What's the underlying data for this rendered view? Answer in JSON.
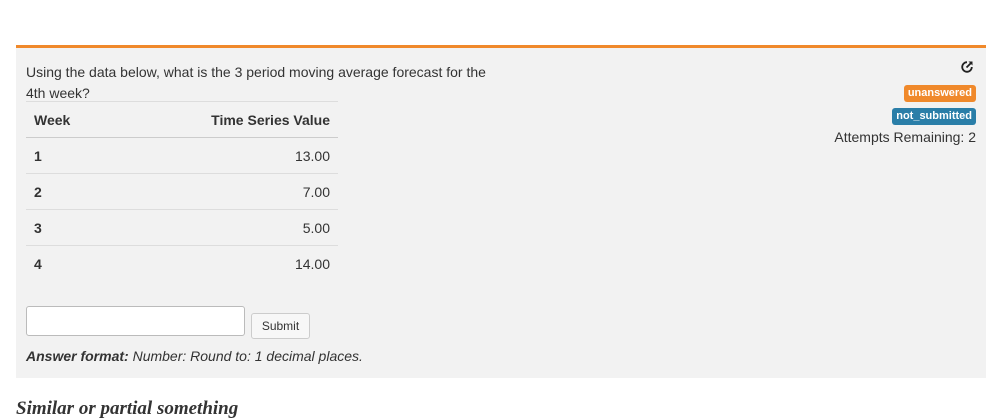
{
  "question": {
    "text": "Using the data below, what is the 3 period moving average forecast for the 4th week?"
  },
  "table": {
    "headers": [
      "Week",
      "Time Series Value"
    ],
    "rows": [
      [
        "1",
        "13.00"
      ],
      [
        "2",
        "7.00"
      ],
      [
        "3",
        "5.00"
      ],
      [
        "4",
        "14.00"
      ]
    ]
  },
  "status": {
    "answered_badge": "unanswered",
    "submitted_badge": "not_submitted",
    "attempts": "Attempts Remaining: 2",
    "icons": [
      "share-icon"
    ],
    "colors": {
      "accent": "#f0892b",
      "badge_blue": "#2a7ea8"
    }
  },
  "answer": {
    "value": "",
    "submit_label": "Submit",
    "format_label": "Answer format:",
    "format_text": " Number: Round to: 1 decimal places."
  },
  "footer": {
    "cut_text": "Similar or partial something"
  }
}
